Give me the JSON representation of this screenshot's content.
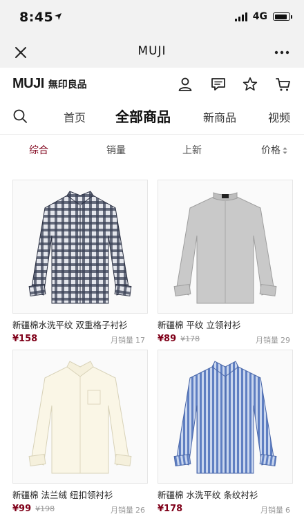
{
  "status": {
    "time": "8:45",
    "network": "4G"
  },
  "nav": {
    "title": "MUJI"
  },
  "header": {
    "logo_latin": "MUJI",
    "logo_cjk": "無印良品"
  },
  "categories": [
    "首页",
    "全部商品",
    "新商品",
    "视频"
  ],
  "sort": {
    "labels": [
      "综合",
      "销量",
      "上新",
      "价格"
    ]
  },
  "products": [
    {
      "title": "新疆棉水洗平纹 双重格子衬衫",
      "price": "¥158",
      "orig": "",
      "sales_label": "月销量",
      "sales": "17"
    },
    {
      "title": "新疆棉 平纹 立领衬衫",
      "price": "¥89",
      "orig": "¥178",
      "sales_label": "月销量",
      "sales": "29"
    },
    {
      "title": "新疆棉 法兰绒 纽扣领衬衫",
      "price": "¥99",
      "orig": "¥198",
      "sales_label": "月销量",
      "sales": "26"
    },
    {
      "title": "新疆棉 水洗平纹 条纹衬衫",
      "price": "¥178",
      "orig": "",
      "sales_label": "月销量",
      "sales": "6"
    }
  ],
  "colors": {
    "accent": "#7f0019",
    "topbar": "#f2f2f2"
  }
}
